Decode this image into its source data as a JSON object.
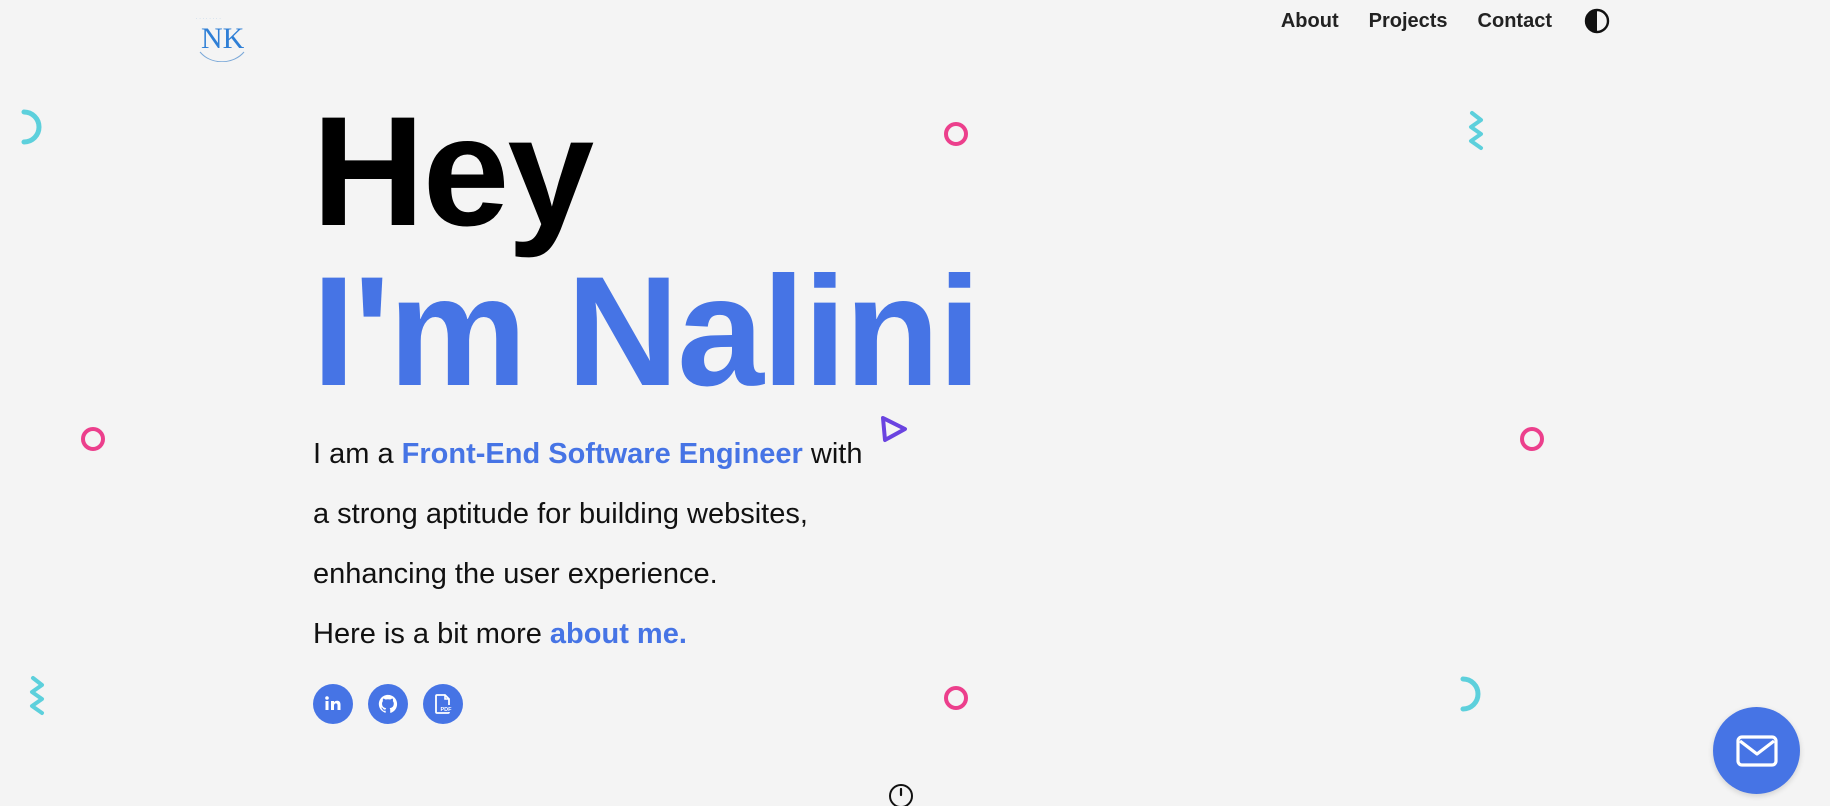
{
  "header": {
    "logo_text": "NK",
    "nav": [
      {
        "label": "About"
      },
      {
        "label": "Projects"
      },
      {
        "label": "Contact"
      }
    ],
    "theme_toggle_icon": "contrast-icon"
  },
  "hero": {
    "line1": "Hey",
    "line2": "I'm Nalini"
  },
  "intro": {
    "prefix": "I am a ",
    "role": "Front-End Software Engineer",
    "suffix": " with a strong aptitude for building websites, enhancing the user experience.",
    "more_prefix": "Here is a bit more ",
    "more_link": "about me."
  },
  "socials": [
    {
      "icon": "linkedin-icon",
      "label": "in"
    },
    {
      "icon": "github-icon"
    },
    {
      "icon": "pdf-resume-icon",
      "label": "PDF"
    }
  ],
  "fab": {
    "icon": "mail-icon"
  },
  "colors": {
    "accent": "#4674e5",
    "pink": "#ec3f8c",
    "cyan": "#5dd0dc",
    "purple": "#6a43e0",
    "background": "#f4f4f4"
  }
}
